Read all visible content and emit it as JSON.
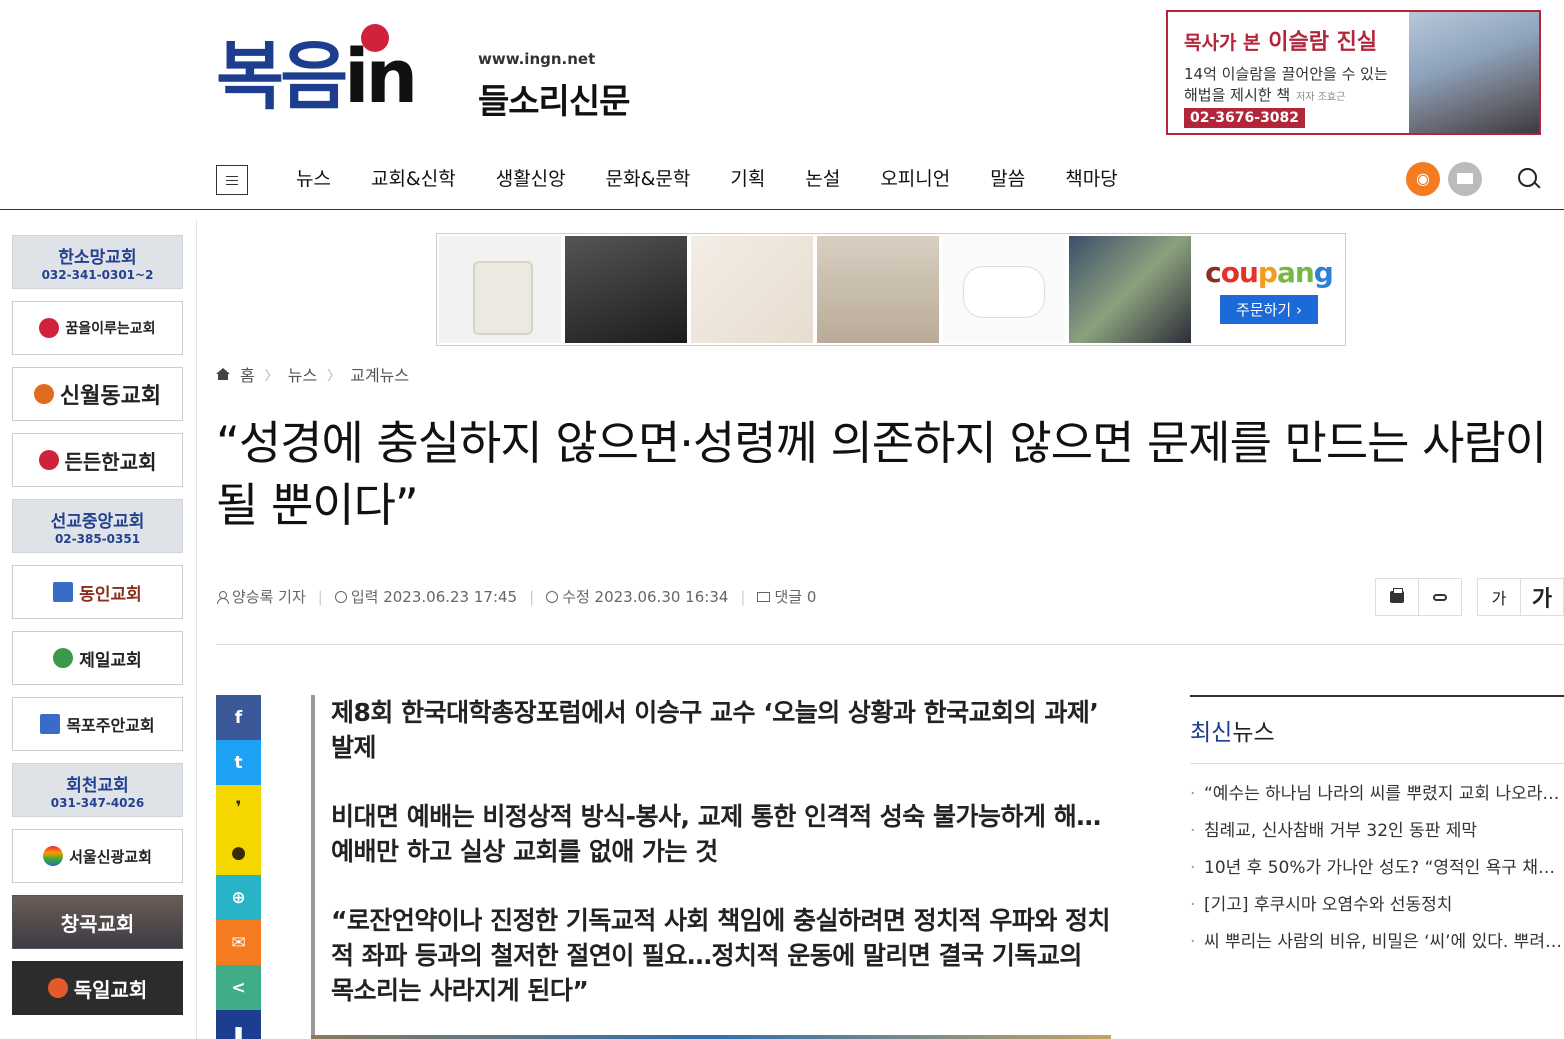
{
  "header": {
    "logo_main": "복음",
    "logo_in": "in",
    "logo_url": "www.ingn.net",
    "logo_sub": "들소리신문"
  },
  "top_ad": {
    "title_small": "목사가 본",
    "title_big": "이슬람 진실",
    "line1": "14억 이슬람을 끌어안을 수 있는",
    "line2": "해법을 제시한 책",
    "author": "저자 조효근",
    "phone": "02-3676-3082"
  },
  "nav": {
    "items": [
      "뉴스",
      "교회&신학",
      "생활신앙",
      "문화&문학",
      "기획",
      "논설",
      "오피니언",
      "말씀",
      "책마당"
    ]
  },
  "left_ads": [
    {
      "name": "한소망교회",
      "phone": "032-341-0301~2"
    },
    {
      "name": "꿈을이루는교회"
    },
    {
      "name": "신월동교회"
    },
    {
      "name": "든든한교회"
    },
    {
      "name": "선교중앙교회",
      "phone": "02-385-0351"
    },
    {
      "name": "동인교회"
    },
    {
      "name": "제일교회"
    },
    {
      "name": "목포주안교회"
    },
    {
      "name": "회천교회",
      "phone": "031-347-4026"
    },
    {
      "name": "서울신광교회"
    },
    {
      "name": "창곡교회"
    },
    {
      "name": "독일교회"
    }
  ],
  "coupang": {
    "logo_parts": [
      "c",
      "ou",
      "p",
      "an",
      "g"
    ],
    "button": "주문하기 ›"
  },
  "breadcrumb": [
    "홈",
    "뉴스",
    "교계뉴스"
  ],
  "article": {
    "title": "“성경에 충실하지 않으면·성령께 의존하지 않으면 문제를 만드는 사람이 될 뿐이다”",
    "author": "양승록 기자",
    "input_date": "입력 2023.06.23 17:45",
    "edit_date": "수정 2023.06.30 16:34",
    "comments": "댓글 0",
    "font_small": "가",
    "font_big": "가",
    "summary": [
      "제8회 한국대학총장포럼에서 이승구 교수 ‘오늘의 상황과 한국교회의 과제’ 발제",
      "비대면 예배는 비정상적 방식-봉사, 교제 통한 인격적 성숙 불가능하게 해…예배만 하고 실상 교회를 없애 가는 것",
      "“로잔언약이나 진정한 기독교적 사회 책임에 충실하려면 정치적 우파와 정치적 좌파 등과의 철저한 절연이 필요…정치적 운동에 말리면 결국 기독교의 목소리는 사라지게 된다”"
    ]
  },
  "share": [
    "f",
    "t",
    "❜",
    "●",
    "⊕",
    "✉",
    "<",
    "▮"
  ],
  "latest": {
    "title_hl": "최신",
    "title_rest": "뉴스",
    "items": [
      "“예수는 하나님 나라의 씨를 뿌렸지 교회 나오라…",
      "침례교, 신사참배 거부 32인 동판 제막",
      "10년 후 50%가 가나안 성도? “영적인 욕구 채워…",
      "[기고] 후쿠시마 오염수와 선동정치",
      "씨 뿌리는 사람의 비유, 비밀은 ‘씨’에 있다. 뿌려…"
    ]
  },
  "colors": {
    "brand_blue": "#1d3d8f",
    "brand_red": "#d0223a",
    "rss_orange": "#f47b20"
  }
}
